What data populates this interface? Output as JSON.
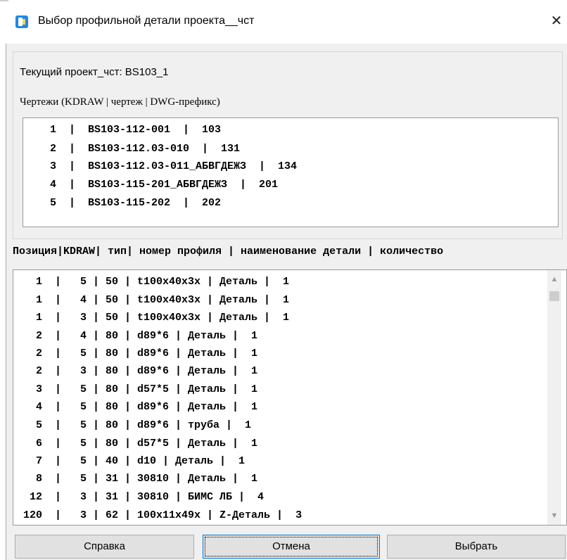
{
  "window": {
    "title": "Выбор профильной детали проекта__чст",
    "close_glyph": "✕"
  },
  "project": {
    "label": "Текущий проект_чст:   BS103_1"
  },
  "drawings": {
    "header": "Чертежи (KDRAW | чертеж | DWG-префикс)",
    "rows": [
      "1  |  BS103-112-001  |  103",
      "2  |  BS103-112.03-010  |  131",
      "3  |  BS103-112.03-011_АБВГДЕЖЗ  |  134",
      "4  |  BS103-115-201_АБВГДЕЖЗ  |  201",
      "5  |  BS103-115-202  |  202"
    ]
  },
  "parts": {
    "header": "Позиция|KDRAW| тип| номер профиля | наименование детали | количество",
    "rows": [
      "  1  |   5 | 50 | t100x40x3x | Деталь |  1",
      "  1  |   4 | 50 | t100x40x3x | Деталь |  1",
      "  1  |   3 | 50 | t100x40x3x | Деталь |  1",
      "  2  |   4 | 80 | d89*6 | Деталь |  1",
      "  2  |   5 | 80 | d89*6 | Деталь |  1",
      "  2  |   3 | 80 | d89*6 | Деталь |  1",
      "  3  |   5 | 80 | d57*5 | Деталь |  1",
      "  4  |   5 | 80 | d89*6 | Деталь |  1",
      "  5  |   5 | 80 | d89*6 | труба |  1",
      "  6  |   5 | 80 | d57*5 | Деталь |  1",
      "  7  |   5 | 40 | d10 | Деталь |  1",
      "  8  |   5 | 31 | 30810 | Деталь |  1",
      " 12  |   3 | 31 | 30810 | БИМС ЛБ |  4",
      "120  |   3 | 62 | 100x11x49x | Z-Деталь |  3"
    ]
  },
  "scrollbar": {
    "up_glyph": "▲",
    "down_glyph": "▼"
  },
  "buttons": {
    "help": "Справка",
    "cancel": "Отмена",
    "select": "Выбрать"
  },
  "colors": {
    "icon_primary": "#1e88e5",
    "icon_accent": "#ffd54f",
    "window_bg": "#f0f0f0"
  }
}
